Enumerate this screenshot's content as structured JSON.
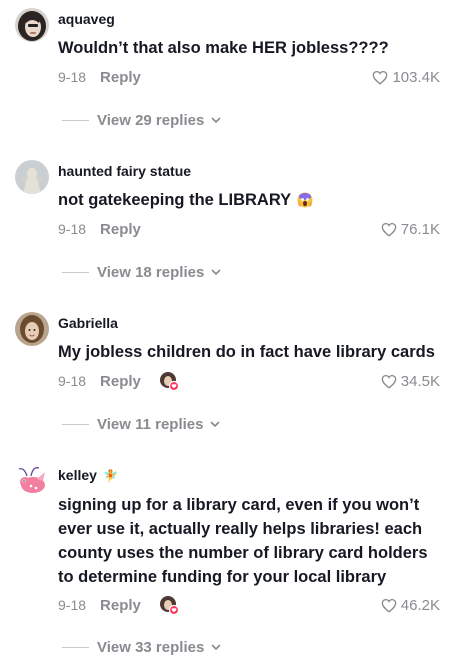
{
  "comments": [
    {
      "username": "aquaveg",
      "text": "Wouldn’t that also make HER jobless????",
      "date": "9-18",
      "reply_label": "Reply",
      "likes": "103.4K",
      "view_replies": "View 29 replies",
      "avatar_colors": {
        "bg": "#d8d2cc",
        "hair": "#2a2522",
        "face": "#e9d8cc"
      }
    },
    {
      "username": "haunted fairy statue",
      "text": "not gatekeeping the LIBRARY",
      "emoji": "😱",
      "date": "9-18",
      "reply_label": "Reply",
      "likes": "76.1K",
      "view_replies": "View 18 replies",
      "avatar_colors": {
        "bg": "#c9cfd3",
        "figure": "#e6e1d6"
      }
    },
    {
      "username": "Gabriella",
      "text": "My jobless children do in fact have library cards",
      "date": "9-18",
      "reply_label": "Reply",
      "likes": "34.5K",
      "view_replies": "View 11 replies",
      "creator_liked": true,
      "avatar_colors": {
        "bg": "#b9a58e",
        "hair": "#6b4a2f",
        "face": "#e7cdb5"
      }
    },
    {
      "username": "kelley",
      "username_badge": "🧚",
      "text": "signing up for a library card, even if you won’t ever use it, actually really helps libraries! each county uses the number of library card holders to determine funding for your local library",
      "date": "9-18",
      "reply_label": "Reply",
      "likes": "46.2K",
      "view_replies": "View 33 replies",
      "creator_liked": true,
      "avatar_colors": {
        "bg": "#ffffff",
        "body": "#f27fa0",
        "accent": "#6a4a9a"
      }
    }
  ],
  "colors": {
    "text_primary": "#161823",
    "text_secondary": "#8a8b91",
    "heart": "#8a8b91",
    "creator_badge": "#fe2c55"
  },
  "icons": {
    "like": "heart-outline-icon",
    "expand": "chevron-down-icon",
    "creator_like": "creator-heart-badge-icon"
  }
}
